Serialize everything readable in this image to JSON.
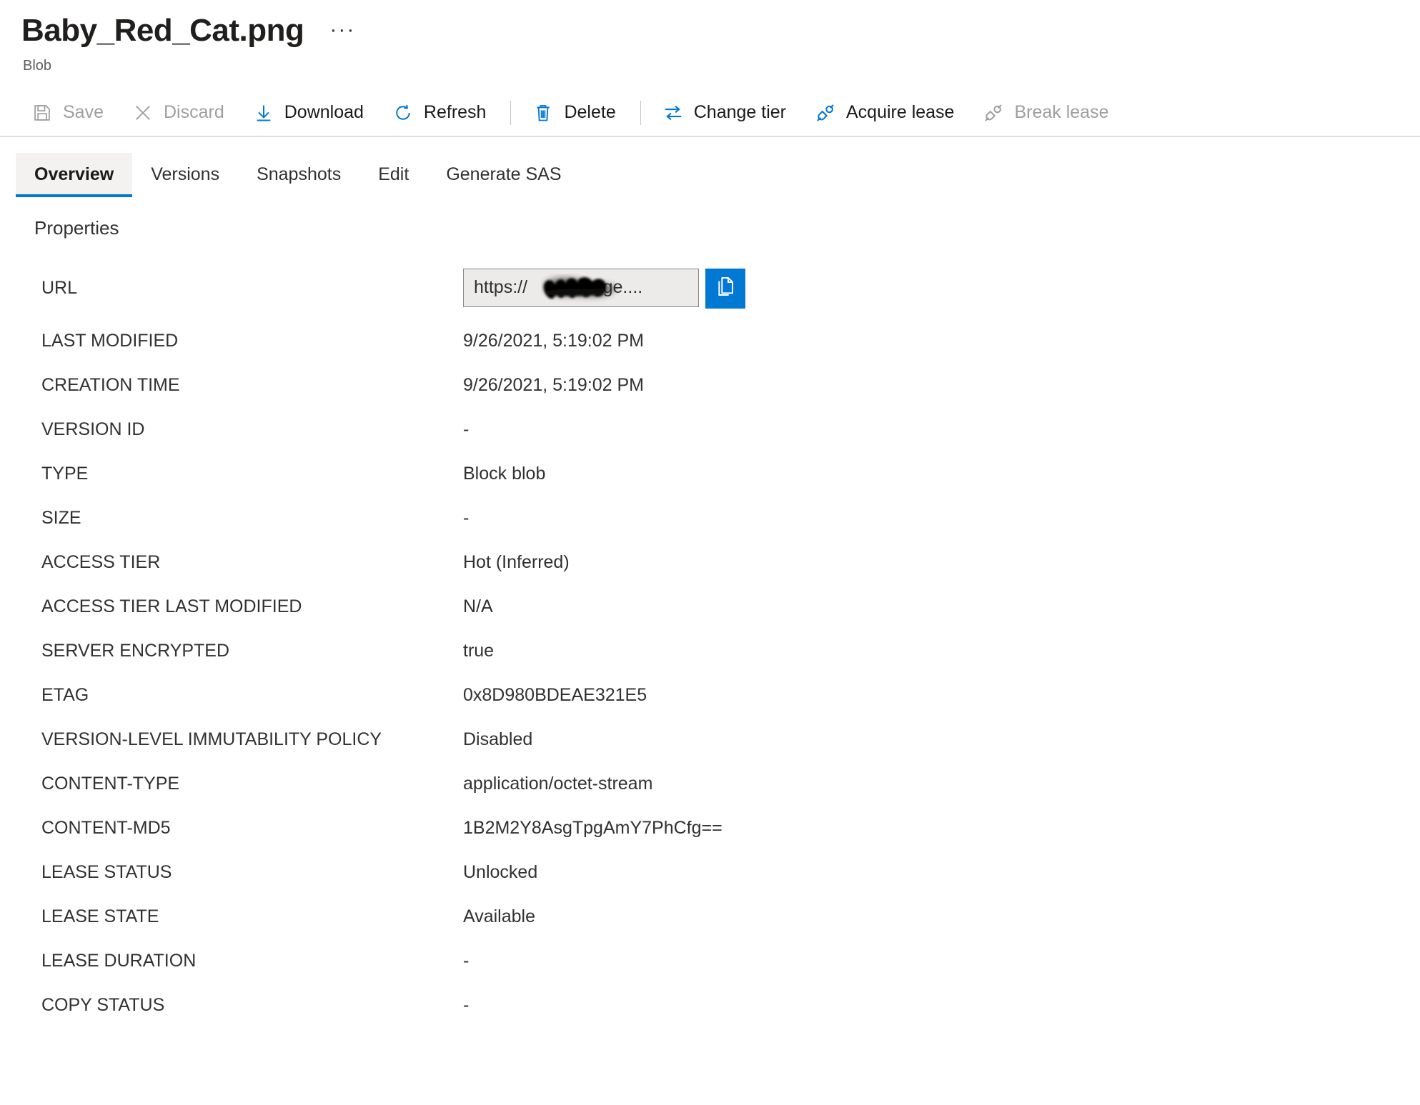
{
  "header": {
    "title": "Baby_Red_Cat.png",
    "more_label": "···",
    "subtitle": "Blob"
  },
  "toolbar": {
    "items": [
      {
        "label": "Save",
        "icon": "save-icon",
        "enabled": false
      },
      {
        "label": "Discard",
        "icon": "discard-icon",
        "enabled": false
      },
      {
        "label": "Download",
        "icon": "download-icon",
        "enabled": true
      },
      {
        "label": "Refresh",
        "icon": "refresh-icon",
        "enabled": true
      },
      {
        "label": "Delete",
        "icon": "delete-icon",
        "enabled": true
      },
      {
        "label": "Change tier",
        "icon": "change-tier-icon",
        "enabled": true
      },
      {
        "label": "Acquire lease",
        "icon": "acquire-lease-icon",
        "enabled": true
      },
      {
        "label": "Break lease",
        "icon": "break-lease-icon",
        "enabled": false
      }
    ]
  },
  "tabs": [
    {
      "label": "Overview",
      "active": true
    },
    {
      "label": "Versions",
      "active": false
    },
    {
      "label": "Snapshots",
      "active": false
    },
    {
      "label": "Edit",
      "active": false
    },
    {
      "label": "Generate SAS",
      "active": false
    }
  ],
  "properties": {
    "heading": "Properties",
    "url": {
      "label": "URL",
      "value": "https://████storage....",
      "prefix": "https://",
      "suffix": "storage....",
      "copy_icon": "copy-icon"
    },
    "rows": [
      {
        "label": "LAST MODIFIED",
        "value": "9/26/2021, 5:19:02 PM"
      },
      {
        "label": "CREATION TIME",
        "value": "9/26/2021, 5:19:02 PM"
      },
      {
        "label": "VERSION ID",
        "value": "-"
      },
      {
        "label": "TYPE",
        "value": "Block blob"
      },
      {
        "label": "SIZE",
        "value": "-"
      },
      {
        "label": "ACCESS TIER",
        "value": "Hot (Inferred)"
      },
      {
        "label": "ACCESS TIER LAST MODIFIED",
        "value": "N/A"
      },
      {
        "label": "SERVER ENCRYPTED",
        "value": "true"
      },
      {
        "label": "ETAG",
        "value": "0x8D980BDEAE321E5"
      },
      {
        "label": "VERSION-LEVEL IMMUTABILITY POLICY",
        "value": "Disabled"
      },
      {
        "label": "CONTENT-TYPE",
        "value": "application/octet-stream"
      },
      {
        "label": "CONTENT-MD5",
        "value": "1B2M2Y8AsgTpgAmY7PhCfg=="
      },
      {
        "label": "LEASE STATUS",
        "value": "Unlocked"
      },
      {
        "label": "LEASE STATE",
        "value": "Available"
      },
      {
        "label": "LEASE DURATION",
        "value": "-"
      },
      {
        "label": "COPY STATUS",
        "value": "-"
      }
    ]
  },
  "colors": {
    "accent": "#0078d4",
    "text": "#323130",
    "disabled": "#a19f9d",
    "field_bg": "#edebe9",
    "tab_active_bg": "#f3f2f1"
  }
}
